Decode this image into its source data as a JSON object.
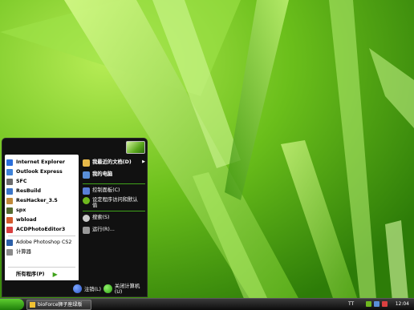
{
  "start_menu": {
    "left_items": [
      {
        "label": "Internet Explorer",
        "icon": "internet-explorer-icon",
        "color": "#2a6fdb"
      },
      {
        "label": "Outlook Express",
        "icon": "outlook-express-icon",
        "color": "#3f83d8"
      },
      {
        "label": "SFC",
        "icon": "sfc-icon",
        "color": "#6a6a6a"
      },
      {
        "label": "ResBuild",
        "icon": "resbuild-icon",
        "color": "#3b76c8"
      },
      {
        "label": "ResHacker_3.5",
        "icon": "reshacker-icon",
        "color": "#c08a3a"
      },
      {
        "label": "spx",
        "icon": "spx-icon",
        "color": "#556b2f"
      },
      {
        "label": "wbload",
        "icon": "wbload-icon",
        "color": "#d35b2c"
      },
      {
        "label": "ACDPhotoEditor3",
        "icon": "acdphotoeditor-icon",
        "color": "#d94040"
      }
    ],
    "left_items_extra": [
      {
        "label": "Adobe Photoshop CS2",
        "icon": "photoshop-icon",
        "color": "#2b5fa8"
      },
      {
        "label": "计算器",
        "icon": "calculator-icon",
        "color": "#8a8a8a"
      }
    ],
    "all_programs": "所有程序(P)",
    "right_items": [
      {
        "label": "我最近的文档(D)",
        "icon": "recent-documents-icon",
        "bold": true,
        "color": "#e7b94a"
      },
      {
        "label": "我的电脑",
        "icon": "my-computer-icon",
        "bold": true,
        "color": "#5a8fd8"
      },
      {
        "label": "控制面板(C)",
        "icon": "control-panel-icon",
        "bold": false,
        "color": "#5a7fd8"
      },
      {
        "label": "设定程序访问和默认值",
        "icon": "program-access-icon",
        "bold": false,
        "color": "#6fb81e"
      },
      {
        "label": "搜索(S)",
        "icon": "search-icon",
        "bold": false,
        "color": "#cccccc"
      },
      {
        "label": "运行(R)...",
        "icon": "run-icon",
        "bold": false,
        "color": "#999999"
      }
    ],
    "logoff": "注销(L)",
    "shutdown": "关闭计算机(U)"
  },
  "taskbar": {
    "task_button": "bioForce狮子座绿版",
    "ime": "TT",
    "clock": "12:04"
  },
  "colors": {
    "accent_green": "#3fa21a",
    "logoff_orb": "#2a55c8",
    "shutdown_orb": "#2ea312"
  }
}
